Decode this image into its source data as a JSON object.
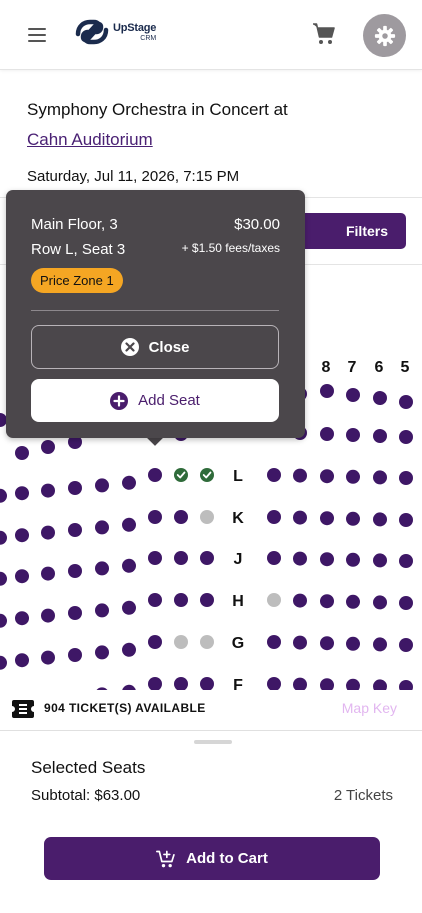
{
  "header": {
    "logo_name": "UpStage",
    "logo_sub": "CRM",
    "menu_icon": "hamburger-icon",
    "cart_icon": "cart-icon",
    "settings_icon": "gear-icon"
  },
  "event": {
    "title": "Symphony Orchestra in Concert at",
    "venue": "Cahn Auditorium",
    "date": "Saturday, Jul 11, 2026, 7:15 PM"
  },
  "filters_label": "Filters",
  "popover": {
    "section": "Main Floor, 3",
    "seat": "Row L, Seat 3",
    "price": "$30.00",
    "fees": "+ $1.50 fees/taxes",
    "price_zone": "Price Zone 1",
    "close_label": "Close",
    "add_label": "Add Seat"
  },
  "seatmap": {
    "seat_numbers": [
      "8",
      "7",
      "6",
      "5"
    ],
    "rows": [
      "L",
      "K",
      "J",
      "H",
      "G",
      "F"
    ],
    "colors": {
      "available": "#3e1766",
      "selected": "#2f6b3a",
      "unavailable": "#bdbdbd"
    }
  },
  "availability": {
    "text": "904 TICKET(S) AVAILABLE",
    "map_key": "Map Key"
  },
  "selection": {
    "title": "Selected Seats",
    "subtotal": "Subtotal: $63.00",
    "tickets": "2 Tickets",
    "add_to_cart": "Add to Cart"
  },
  "colors": {
    "brand": "#4a1d6c",
    "price_zone": "#f5a623",
    "popover_bg": "#4b474b"
  }
}
